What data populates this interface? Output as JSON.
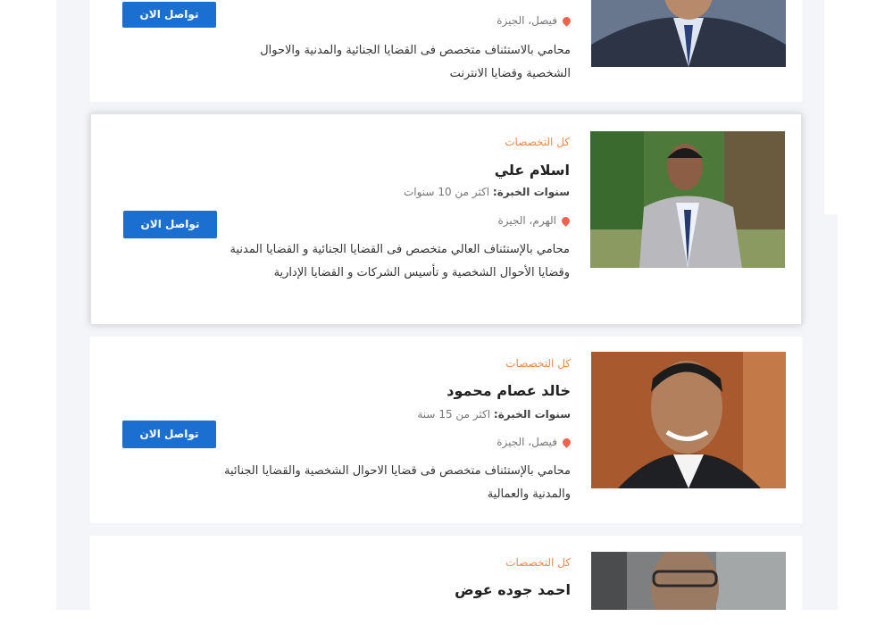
{
  "lawyers": [
    {
      "specialty_link": "",
      "name": "",
      "experience_label": "",
      "experience_value": "",
      "location": "فيصل، الجيزة",
      "description": "محامي بالاستئناف متخصص فى القضايا الجنائية والمدنية والاحوال الشخصية وقضايا الانترنت",
      "contact_label": "تواصل الان"
    },
    {
      "specialty_link": "كل التخصصات",
      "name": "اسلام علي",
      "experience_label": "سنوات الخبرة:",
      "experience_value": "اكثر من 10 سنوات",
      "location": "الهرم، الجيزة",
      "description": "محامي بالإستئناف العالي متخصص فى القضايا الجنائية و القضايا المدنية وقضايا الأحوال الشخصية و تأسيس الشركات و القضايا الإدارية",
      "contact_label": "تواصل الان"
    },
    {
      "specialty_link": "كل التخصصات",
      "name": "خالد عصام محمود",
      "experience_label": "سنوات الخبرة:",
      "experience_value": "اكثر من 15 سنة",
      "location": "فيصل، الجيزة",
      "description": "محامي بالإستئناف متخصص فى قضايا الاحوال الشخصية والقضايا الجنائية والمدنية والعمالية",
      "contact_label": "تواصل الان"
    },
    {
      "specialty_link": "كل التخصصات",
      "name": "احمد جوده عوض",
      "experience_label": "",
      "experience_value": "",
      "location": "",
      "description": "",
      "contact_label": ""
    }
  ],
  "colors": {
    "accent": "#1a6fd0",
    "specialty": "#f08a4b",
    "pin": "#f2624b",
    "background": "#f4f5f9"
  },
  "icons": {
    "location": "map-pin-icon"
  }
}
